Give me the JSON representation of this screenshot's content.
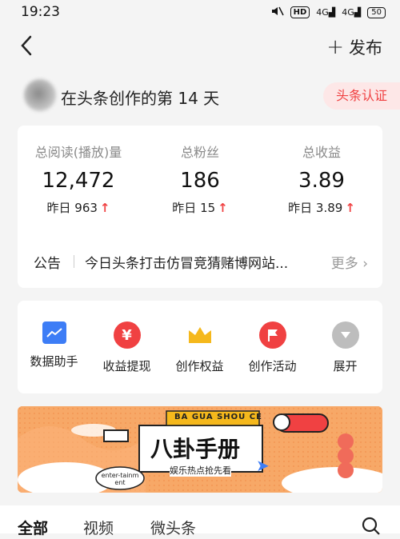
{
  "status_bar": {
    "time": "19:23",
    "signal1": "4G",
    "signal2": "4G",
    "hd": "HD",
    "battery": "50"
  },
  "header": {
    "publish_label": "发布"
  },
  "creator": {
    "days_text": "在头条创作的第 14 天",
    "badge": "头条认证"
  },
  "stats": [
    {
      "label": "总阅读(播放)量",
      "value": "12,472",
      "delta_prefix": "昨日",
      "delta": "963"
    },
    {
      "label": "总粉丝",
      "value": "186",
      "delta_prefix": "昨日",
      "delta": "15"
    },
    {
      "label": "总收益",
      "value": "3.89",
      "delta_prefix": "昨日",
      "delta": "3.89"
    }
  ],
  "notice": {
    "label": "公告",
    "text": "今日头条打击仿冒竞猜赌博网站...",
    "more": "更多"
  },
  "tools": [
    {
      "label": "数据助手",
      "icon": "chart-icon",
      "color": "#3d7df6"
    },
    {
      "label": "收益提现",
      "icon": "yuan-icon",
      "color": "#f04142"
    },
    {
      "label": "创作权益",
      "icon": "crown-icon",
      "color": "#f5b81c"
    },
    {
      "label": "创作活动",
      "icon": "flag-icon",
      "color": "#f04142"
    },
    {
      "label": "展开",
      "icon": "expand-icon",
      "color": "#bdbdbd"
    }
  ],
  "banner": {
    "top_text": "BA GUA SHOU CE",
    "title": "八卦手册",
    "subtitle": "娱乐热点抢先看",
    "tag": "enter-tainment"
  },
  "tabs": [
    {
      "label": "全部",
      "active": true
    },
    {
      "label": "视频",
      "active": false
    },
    {
      "label": "微头条",
      "active": false
    }
  ]
}
